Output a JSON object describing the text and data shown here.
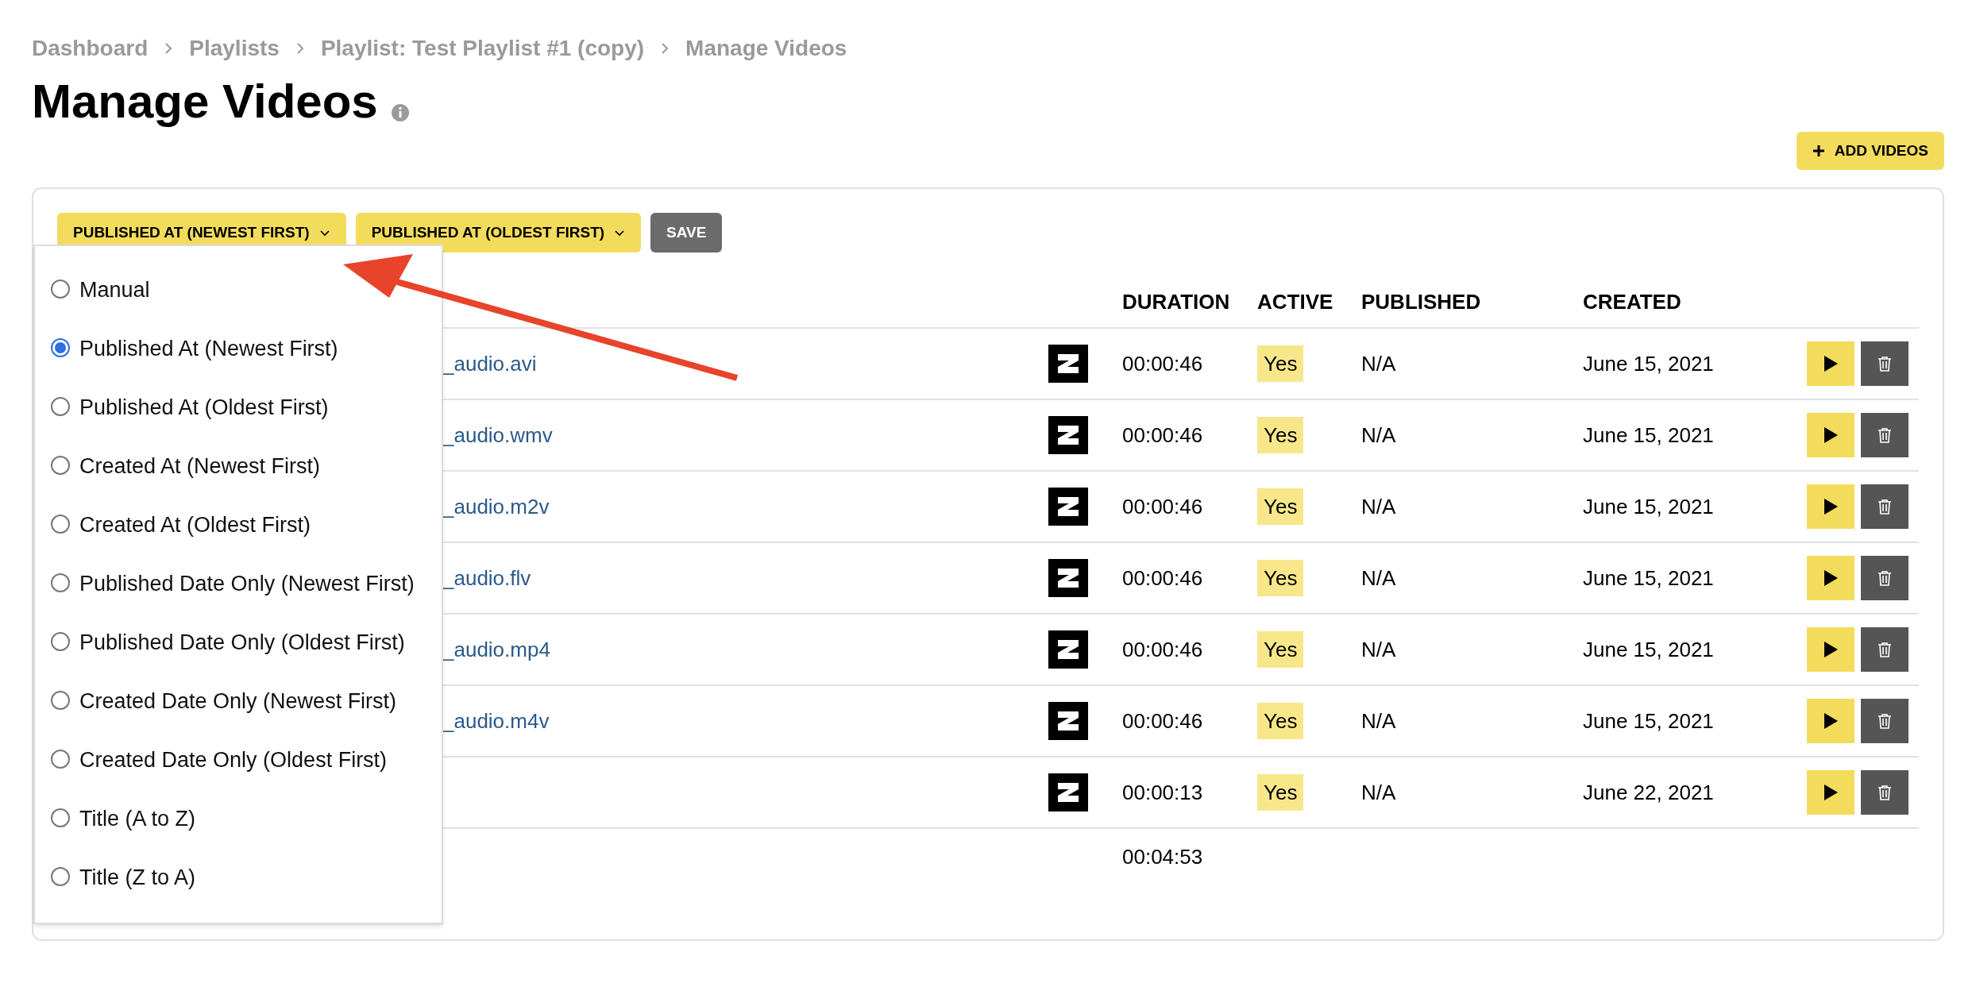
{
  "breadcrumbs": [
    "Dashboard",
    "Playlists",
    "Playlist: Test Playlist #1 (copy)",
    "Manage Videos"
  ],
  "title": "Manage Videos",
  "add_button": "ADD VIDEOS",
  "sort_buttons": [
    {
      "label": "PUBLISHED AT (NEWEST FIRST)",
      "kind": "dropdown"
    },
    {
      "label": "PUBLISHED AT (OLDEST FIRST)",
      "kind": "dropdown"
    },
    {
      "label": "SAVE",
      "kind": "save"
    }
  ],
  "sort_menu": {
    "options": [
      {
        "label": "Manual",
        "selected": false
      },
      {
        "label": "Published At (Newest First)",
        "selected": true
      },
      {
        "label": "Published At (Oldest First)",
        "selected": false
      },
      {
        "label": "Created At (Newest First)",
        "selected": false
      },
      {
        "label": "Created At (Oldest First)",
        "selected": false
      },
      {
        "label": "Published Date Only (Newest First)",
        "selected": false
      },
      {
        "label": "Published Date Only (Oldest First)",
        "selected": false
      },
      {
        "label": "Created Date Only (Newest First)",
        "selected": false
      },
      {
        "label": "Created Date Only (Oldest First)",
        "selected": false
      },
      {
        "label": "Title (A to Z)",
        "selected": false
      },
      {
        "label": "Title (Z to A)",
        "selected": false
      }
    ]
  },
  "table": {
    "columns": [
      "DURATION",
      "ACTIVE",
      "PUBLISHED",
      "CREATED"
    ],
    "rows": [
      {
        "title": "_audio.avi",
        "duration": "00:00:46",
        "active": "Yes",
        "published": "N/A",
        "created": "June 15, 2021"
      },
      {
        "title": "_audio.wmv",
        "duration": "00:00:46",
        "active": "Yes",
        "published": "N/A",
        "created": "June 15, 2021"
      },
      {
        "title": "_audio.m2v",
        "duration": "00:00:46",
        "active": "Yes",
        "published": "N/A",
        "created": "June 15, 2021"
      },
      {
        "title": "_audio.flv",
        "duration": "00:00:46",
        "active": "Yes",
        "published": "N/A",
        "created": "June 15, 2021"
      },
      {
        "title": "_audio.mp4",
        "duration": "00:00:46",
        "active": "Yes",
        "published": "N/A",
        "created": "June 15, 2021"
      },
      {
        "title": "_audio.m4v",
        "duration": "00:00:46",
        "active": "Yes",
        "published": "N/A",
        "created": "June 15, 2021"
      },
      {
        "duration": "00:00:13",
        "active": "Yes",
        "published": "N/A",
        "created": "June 22, 2021"
      }
    ],
    "total_duration": "00:04:53"
  }
}
